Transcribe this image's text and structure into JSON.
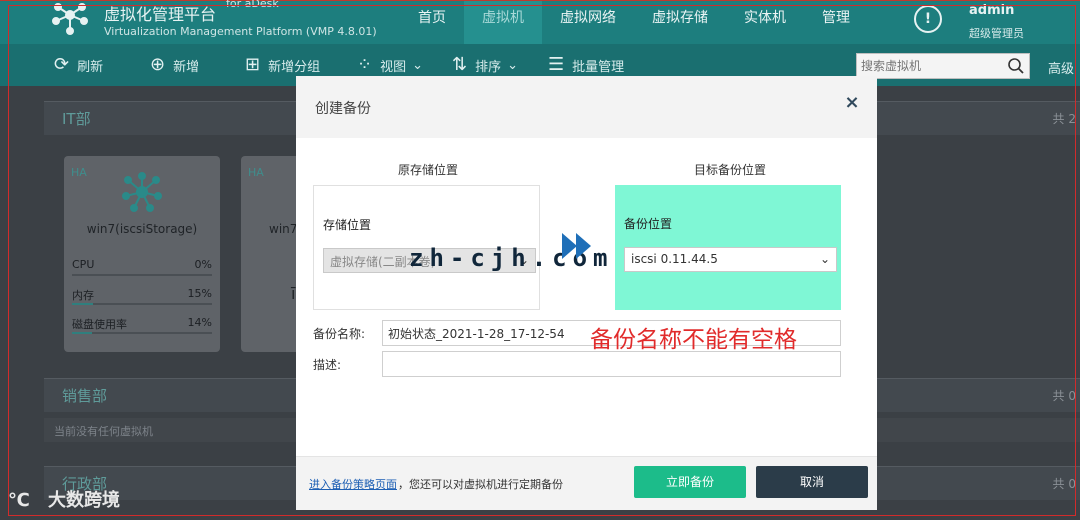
{
  "app": {
    "title": "虚拟化管理平台",
    "for_text": "for aDesk",
    "subtitle": "Virtualization Management Platform (VMP 4.8.01)"
  },
  "nav": {
    "items": [
      {
        "label": "首页"
      },
      {
        "label": "虚拟机"
      },
      {
        "label": "虚拟网络"
      },
      {
        "label": "虚拟存储"
      },
      {
        "label": "实体机"
      },
      {
        "label": "管理"
      }
    ],
    "active": "虚拟机"
  },
  "user": {
    "name": "admin",
    "role": "超级管理员"
  },
  "toolbar": {
    "refresh": "刷新",
    "add": "新增",
    "add_group": "新增分组",
    "view": "视图",
    "sort": "排序",
    "batch": "批量管理",
    "search_placeholder": "搜索虚拟机",
    "advanced": "高级"
  },
  "groups": [
    {
      "name": "IT部",
      "count": "共 2"
    },
    {
      "name": "销售部",
      "count": "共 0",
      "empty_note": "当前没有任何虚拟机"
    },
    {
      "name": "行政部",
      "count": "共 0"
    }
  ],
  "vm_cards": [
    {
      "ha": "HA",
      "name": "win7(iscsiStorage)",
      "metrics": [
        {
          "label": "CPU",
          "value": "0%",
          "fraction": 0.0
        },
        {
          "label": "内存",
          "value": "15%",
          "fraction": 0.15
        },
        {
          "label": "磁盘使用率",
          "value": "14%",
          "fraction": 0.14
        }
      ]
    },
    {
      "ha": "HA",
      "name": "win7",
      "extra": "ī"
    }
  ],
  "modal": {
    "title": "创建备份",
    "close": "×",
    "src_head": "原存储位置",
    "dst_head": "目标备份位置",
    "src_label": "存储位置",
    "src_value": "虚拟存储(二副本卷)",
    "dst_label": "备份位置",
    "dst_value": "iscsi 0.11.44.5",
    "name_label": "备份名称:",
    "name_value": "初始状态_2021-1-28_17-12-54",
    "desc_label": "描述:",
    "desc_value": "",
    "warning": "备份名称不能有空格",
    "watermark": "zh-cjh.com",
    "policy_link": "进入备份策略页面",
    "policy_note": "，您还可以对虚拟机进行定期备份",
    "confirm": "立即备份",
    "cancel": "取消"
  },
  "corner_brand": "大数跨境",
  "colors": {
    "accent": "#1cbc8a",
    "nav": "#1d7e7e",
    "dst_panel": "#7ff7d5",
    "warning": "#e12b2b"
  }
}
